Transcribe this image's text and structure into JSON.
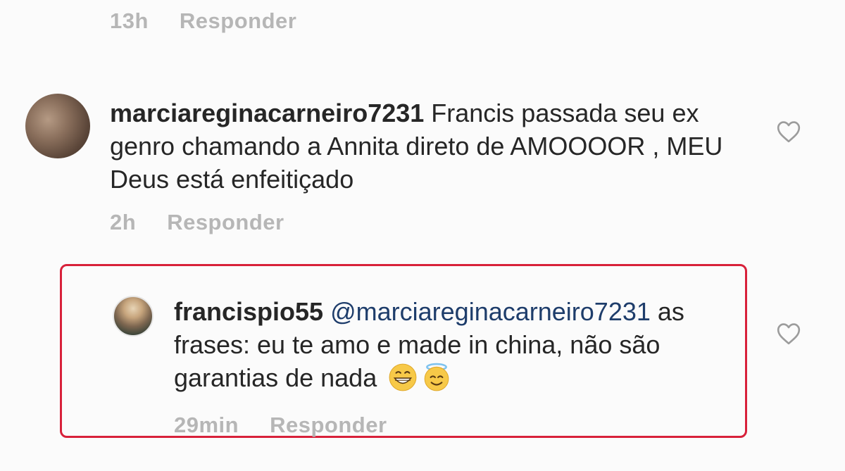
{
  "previous_comment": {
    "time": "13h",
    "reply_label": "Responder"
  },
  "comment_1": {
    "username": "marciareginacarneiro7231",
    "text": " Francis passada seu ex genro chamando a Annita direto de AMOOOOR , MEU Deus está enfeitiçado",
    "time": "2h",
    "reply_label": "Responder",
    "avatar_icon": "profile-photo",
    "like_icon": "heart-outline-icon"
  },
  "comment_2": {
    "username": "francispio55",
    "mention": "@marciareginacarneiro7231",
    "text": " as frases: eu te amo e made in china, não são garantias de nada ",
    "emojis": [
      "grinning-face-emoji",
      "smiling-face-with-halo-emoji"
    ],
    "time": "29min",
    "reply_label": "Responder",
    "avatar_icon": "profile-photo",
    "like_icon": "heart-outline-icon",
    "highlight_color": "#d8213a"
  }
}
